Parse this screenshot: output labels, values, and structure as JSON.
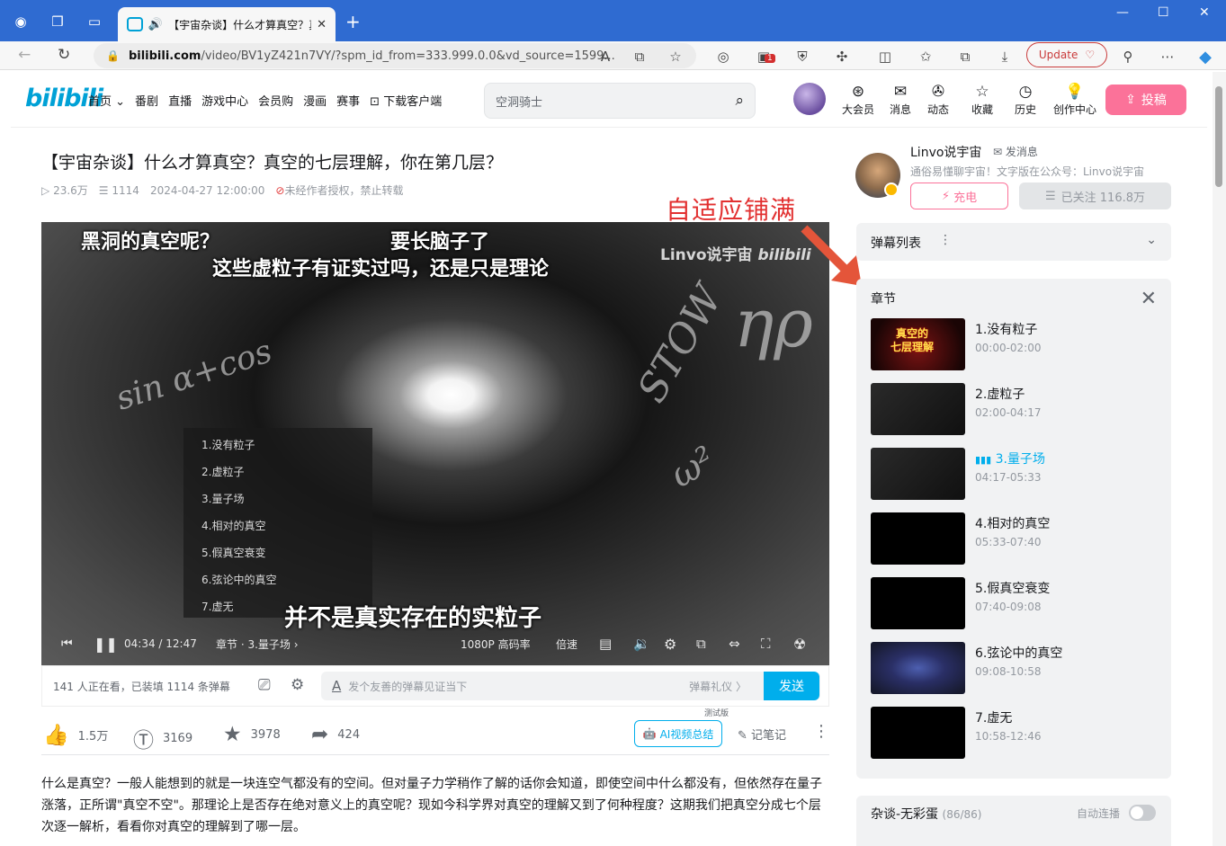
{
  "browser": {
    "tab_title": "【宇宙杂谈】什么才算真空？真空的七层理解，你在第几层？",
    "url_domain": "bilibili.com",
    "url_path": "/video/BV1yZ421n7VY/?spm_id_from=333.999.0.0&vd_source=1599...",
    "update_label": "Update",
    "ext_badge": "1"
  },
  "header": {
    "logo": "bilibili",
    "menu": [
      "首页",
      "番剧",
      "直播",
      "游戏中心",
      "会员购",
      "漫画",
      "赛事",
      "下载客户端"
    ],
    "search_placeholder": "空洞骑士",
    "icons": [
      "大会员",
      "消息",
      "动态",
      "收藏",
      "历史",
      "创作中心"
    ],
    "upload_label": "投稿"
  },
  "video": {
    "title": "【宇宙杂谈】什么才算真空？真空的七层理解，你在第几层？",
    "views": "23.6万",
    "danmaku_count": "1114",
    "date": "2024-04-27 12:00:00",
    "copyright": "未经作者授权，禁止转载"
  },
  "player": {
    "subtitle_top1": "黑洞的真空呢？",
    "subtitle_top2": "要长脑子了",
    "subtitle_top3": "这些虚粒子有证实过吗，还是只是理论",
    "subtitle_bottom": "并不是真实存在的实粒子",
    "watermark": "Linvo说宇宙",
    "chapter_menu": [
      "1.没有粒子",
      "2.虚粒子",
      "3.量子场",
      "4.相对的真空",
      "5.假真空衰变",
      "6.弦论中的真空",
      "7.虚无"
    ],
    "time_current": "04:34",
    "time_total": "12:47",
    "chapter_label": "章节 · 3.量子场",
    "quality": "1080P 高码率",
    "speed": "倍速"
  },
  "danmaku_bar": {
    "status": "141 人正在看，已装填 1114 条弹幕",
    "placeholder": "发个友善的弹幕见证当下",
    "etiquette": "弹幕礼仪 〉",
    "send_label": "发送"
  },
  "actions": {
    "like": "1.5万",
    "coin": "3169",
    "fav": "3978",
    "share": "424",
    "ai_summary": "AI视频总结",
    "test_tag": "测试版",
    "note": "记笔记"
  },
  "description": "什么是真空？一般人能想到的就是一块连空气都没有的空间。但对量子力学稍作了解的话你会知道，即使空间中什么都没有，但依然存在量子涨落，正所谓\"真空不空\"。那理论上是否存在绝对意义上的真空呢？现如今科学界对真空的理解又到了何种程度？这期我们把真空分成七个层次逐一解析，看看你对真空的理解到了哪一层。",
  "uploader": {
    "name": "Linvo说宇宙",
    "message_label": "发消息",
    "sign": "通俗易懂聊宇宙！文字版在公众号：Linvo说宇宙",
    "charge_label": "充电",
    "followed_label": "已关注 116.8万"
  },
  "annotation": "自适应铺满",
  "danmaku_list": {
    "title": "弹幕列表"
  },
  "chapters": {
    "title": "章节",
    "thumb_title": "真空的\n七层理解",
    "items": [
      {
        "name": "1.没有粒子",
        "time": "00:00-02:00"
      },
      {
        "name": "2.虚粒子",
        "time": "02:00-04:17"
      },
      {
        "name": "3.量子场",
        "time": "04:17-05:33"
      },
      {
        "name": "4.相对的真空",
        "time": "05:33-07:40"
      },
      {
        "name": "5.假真空衰变",
        "time": "07:40-09:08"
      },
      {
        "name": "6.弦论中的真空",
        "time": "09:08-10:58"
      },
      {
        "name": "7.虚无",
        "time": "10:58-12:46"
      }
    ],
    "active_index": 2
  },
  "playlist": {
    "title": "杂谈-无彩蛋",
    "count": "(86/86)",
    "autoplay_label": "自动连播",
    "autoplay_on": false
  }
}
